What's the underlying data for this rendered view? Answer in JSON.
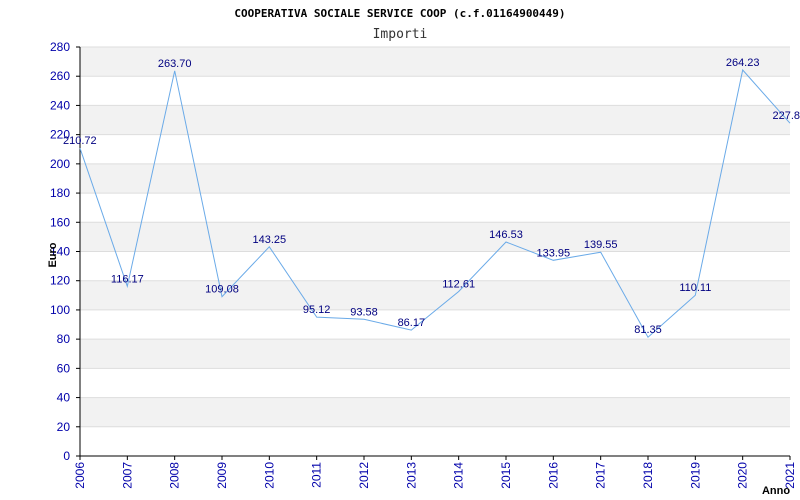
{
  "chart_data": {
    "type": "line",
    "title": "COOPERATIVA SOCIALE SERVICE COOP (c.f.01164900449)",
    "subtitle": "Importi",
    "xlabel": "Anno",
    "ylabel": "Euro",
    "ylim": [
      0,
      280
    ],
    "yticks": [
      "0",
      "20",
      "40",
      "60",
      "80",
      "100",
      "120",
      "140",
      "160",
      "180",
      "200",
      "220",
      "240",
      "260",
      "280"
    ],
    "categories": [
      "2006",
      "2007",
      "2008",
      "2009",
      "2010",
      "2011",
      "2012",
      "2013",
      "2014",
      "2015",
      "2016",
      "2017",
      "2018",
      "2019",
      "2020",
      "2021"
    ],
    "values": [
      210.72,
      116.17,
      263.7,
      109.08,
      143.25,
      95.12,
      93.58,
      86.17,
      112.61,
      146.53,
      133.95,
      139.55,
      81.35,
      110.11,
      264.23,
      227.8
    ],
    "value_labels": [
      "210.72",
      "116.17",
      "263.70",
      "109.08",
      "143.25",
      "95.12",
      "93.58",
      "86.17",
      "112.61",
      "146.53",
      "133.95",
      "139.55",
      "81.35",
      "110.11",
      "264.23",
      "227.8"
    ],
    "grid": true,
    "colors": {
      "line": "#6aaae8",
      "band": "#f2f2f2",
      "gridline": "#dddddd",
      "axis": "#000000",
      "tick_text": "#0000aa",
      "data_label": "#000080"
    }
  }
}
